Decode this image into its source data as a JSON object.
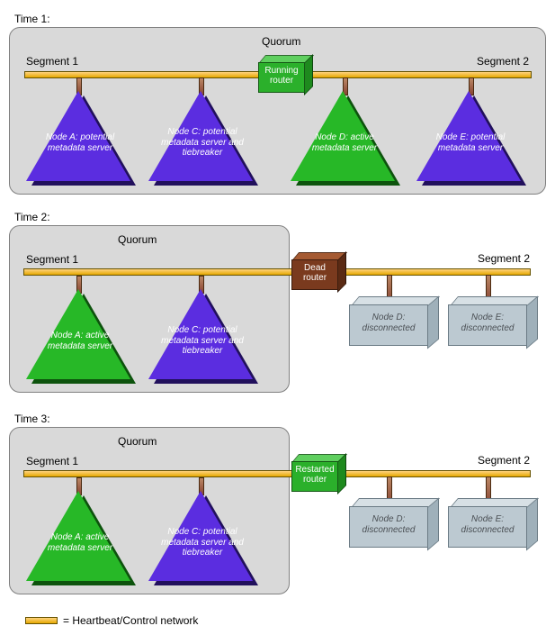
{
  "legend": "= Heartbeat/Control network",
  "time1": {
    "label": "Time 1:",
    "quorum": "Quorum",
    "seg1": "Segment 1",
    "seg2": "Segment 2",
    "router": "Running router",
    "nodes": {
      "a": "Node A: potential metadata server",
      "c": "Node C: potential metadata server and tiebreaker",
      "d": "Node D: active metadata server",
      "e": "Node E: potential metadata server"
    }
  },
  "time2": {
    "label": "Time 2:",
    "quorum": "Quorum",
    "seg1": "Segment 1",
    "seg2": "Segment 2",
    "router": "Dead router",
    "nodes": {
      "a": "Node A: active metadata server",
      "c": "Node C: potential metadata server and tiebreaker",
      "d": "Node D: disconnected",
      "e": "Node E: disconnected"
    }
  },
  "time3": {
    "label": "Time 3:",
    "quorum": "Quorum",
    "seg1": "Segment 1",
    "seg2": "Segment 2",
    "router": "Restarted router",
    "nodes": {
      "a": "Node A: active metadata server",
      "c": "Node C: potential metadata server and tiebreaker",
      "d": "Node D: disconnected",
      "e": "Node E: disconnected"
    }
  }
}
